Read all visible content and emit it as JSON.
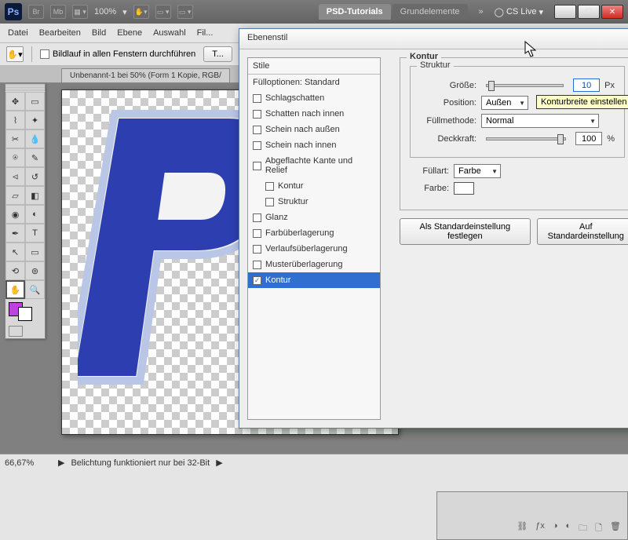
{
  "appbar": {
    "logo": "Ps",
    "br": "Br",
    "mb": "Mb",
    "zoom": "100%",
    "tabs": {
      "active": "PSD-Tutorials",
      "other": "Grundelemente"
    },
    "chev": "»",
    "cslive": "CS Live"
  },
  "menu": [
    "Datei",
    "Bearbeiten",
    "Bild",
    "Ebene",
    "Auswahl",
    "Fil..."
  ],
  "optbar": {
    "scroll_all": "Bildlauf in allen Fenstern durchführen",
    "btn": "T..."
  },
  "doc_tab": "Unbenannt-1 bei 50% (Form 1 Kopie, RGB/",
  "status": {
    "zoom": "66,67%",
    "msg": "Belichtung funktioniert nur bei 32-Bit"
  },
  "dialog": {
    "title": "Ebenenstil",
    "list_header": "Stile",
    "items": [
      {
        "label": "Fülloptionen: Standard",
        "checked": null,
        "sub": false
      },
      {
        "label": "Schlagschatten",
        "checked": false,
        "sub": false
      },
      {
        "label": "Schatten nach innen",
        "checked": false,
        "sub": false
      },
      {
        "label": "Schein nach außen",
        "checked": false,
        "sub": false
      },
      {
        "label": "Schein nach innen",
        "checked": false,
        "sub": false
      },
      {
        "label": "Abgeflachte Kante und Relief",
        "checked": false,
        "sub": false
      },
      {
        "label": "Kontur",
        "checked": false,
        "sub": true
      },
      {
        "label": "Struktur",
        "checked": false,
        "sub": true
      },
      {
        "label": "Glanz",
        "checked": false,
        "sub": false
      },
      {
        "label": "Farbüberlagerung",
        "checked": false,
        "sub": false
      },
      {
        "label": "Verlaufsüberlagerung",
        "checked": false,
        "sub": false
      },
      {
        "label": "Musterüberlagerung",
        "checked": false,
        "sub": false
      },
      {
        "label": "Kontur",
        "checked": true,
        "sub": false,
        "selected": true
      }
    ],
    "panel": {
      "title": "Kontur",
      "struct_title": "Struktur",
      "size_label": "Größe:",
      "size_value": "10",
      "size_unit": "Px",
      "pos_label": "Position:",
      "pos_value": "Außen",
      "blend_label": "Füllmethode:",
      "blend_value": "Normal",
      "opacity_label": "Deckkraft:",
      "opacity_value": "100",
      "opacity_unit": "%",
      "fill_label": "Füllart:",
      "fill_value": "Farbe",
      "color_label": "Farbe:",
      "tooltip": "Konturbreite einstellen",
      "btn_default": "Als Standardeinstellung festlegen",
      "btn_reset": "Auf Standardeinstellung"
    }
  }
}
